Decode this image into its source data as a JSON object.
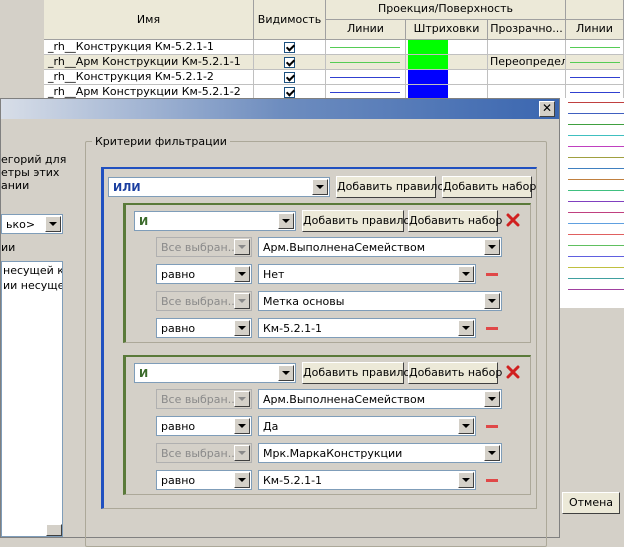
{
  "table": {
    "headers": {
      "name": "Имя",
      "visibility": "Видимость",
      "projection_group": "Проекция/Поверхность",
      "lines": "Линии",
      "hatch": "Штриховки",
      "transparency": "Прозрачно...",
      "lines2": "Линии"
    },
    "rows": [
      {
        "name": "_rh__Конструкция Км-5.2.1-1",
        "visible": true,
        "hatch_color": "#00ff00",
        "line_color": "#55cc55",
        "right_color": "#55cc55",
        "transparency": ""
      },
      {
        "name": "_rh__Арм Конструкции Км-5.2.1-1",
        "visible": true,
        "hatch_color": "#00ff00",
        "line_color": "#55cc55",
        "right_color": "#55cc55",
        "transparency": "Переопределить"
      },
      {
        "name": "_rh__Конструкция Км-5.2.1-2",
        "visible": true,
        "hatch_color": "#0000ff",
        "line_color": "#3040d0",
        "right_color": "#3040d0",
        "transparency": ""
      },
      {
        "name": "_rh__Арм Конструкции Км-5.2.1-2",
        "visible": true,
        "hatch_color": "#0000ff",
        "line_color": "#3040d0",
        "right_color": "#3040d0",
        "transparency": ""
      }
    ],
    "extra_line_colors": [
      "#c04040",
      "#4060c0",
      "#40a040",
      "#40c0c0",
      "#c040c0",
      "#a0a040",
      "#4080c0",
      "#c08040",
      "#40c080",
      "#8040c0",
      "#c04080",
      "#60a0e0",
      "#e06060",
      "#60c060",
      "#6060e0",
      "#c0c040",
      "#40a0a0",
      "#a040a0"
    ]
  },
  "dialog": {
    "close_label": "✕",
    "left_text": [
      "егорий для",
      "етры этих",
      "ании"
    ],
    "left_combo": "ько>",
    "left_label": "ии",
    "left_list": [
      "несущей конс",
      "ии несущей к"
    ],
    "group_title": "Критерии фильтрации",
    "root": {
      "operator": "ИЛИ",
      "add_rule": "Добавить правило",
      "add_set": "Добавить набор",
      "color": "#2050c0"
    },
    "sets": [
      {
        "operator": "И",
        "add_rule": "Добавить правило",
        "add_set": "Добавить набор",
        "rules": [
          {
            "category": "Все выбран...",
            "param": "Арм.ВыполненаСемейством"
          },
          {
            "op": "равно",
            "value": "Нет"
          },
          {
            "category": "Все выбран...",
            "param": "Метка основы"
          },
          {
            "op": "равно",
            "value": "Км-5.2.1-1"
          }
        ]
      },
      {
        "operator": "И",
        "add_rule": "Добавить правило",
        "add_set": "Добавить набор",
        "rules": [
          {
            "category": "Все выбран...",
            "param": "Арм.ВыполненаСемейством"
          },
          {
            "op": "равно",
            "value": "Да"
          },
          {
            "category": "Все выбран...",
            "param": "Мрк.МаркаКонструкции"
          },
          {
            "op": "равно",
            "value": "Км-5.2.1-1"
          }
        ]
      }
    ],
    "set_color": "#5a7a3a",
    "cancel_label": "Отмена"
  }
}
